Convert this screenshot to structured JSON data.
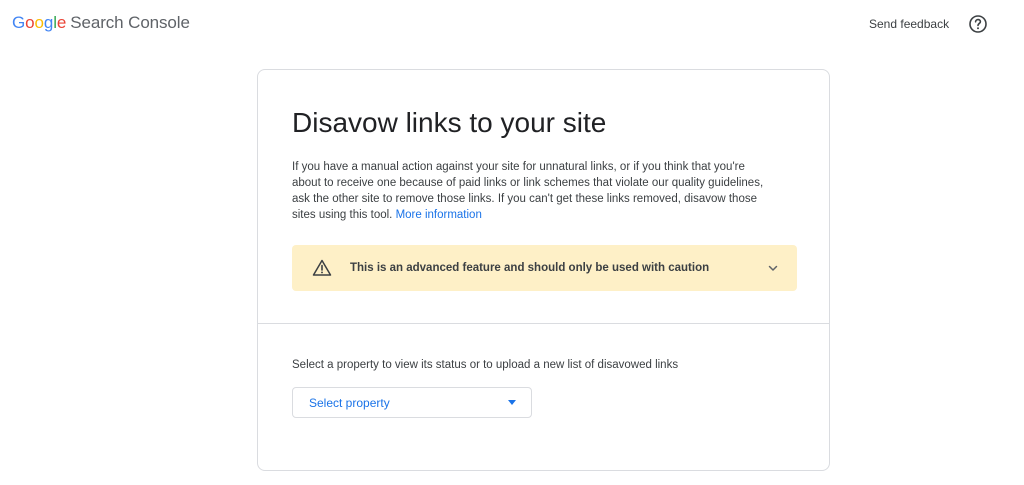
{
  "header": {
    "logo": {
      "g1": "G",
      "g2": "o",
      "g3": "o",
      "g4": "g",
      "g5": "l",
      "g6": "e"
    },
    "product_name": "Search Console",
    "send_feedback": "Send feedback",
    "help_icon": "help-circle-icon"
  },
  "card": {
    "title": "Disavow links to your site",
    "description": "If you have a manual action against your site for unnatural links, or if you think that you're about to receive one because of paid links or link schemes that violate our quality guidelines, ask the other site to remove those links. If you can't get these links removed, disavow those sites using this tool.",
    "more_info_link": "More information",
    "warning": {
      "icon": "warning-triangle-icon",
      "text": "This is an advanced feature and should only be used with caution",
      "expand_icon": "chevron-down-icon"
    },
    "select_label": "Select a property to view its status or to upload a new list of disavowed links",
    "select_value": "Select property"
  },
  "colors": {
    "accent": "#1a73e8",
    "warning_bg": "#fef0c7",
    "border": "#dadce0"
  }
}
